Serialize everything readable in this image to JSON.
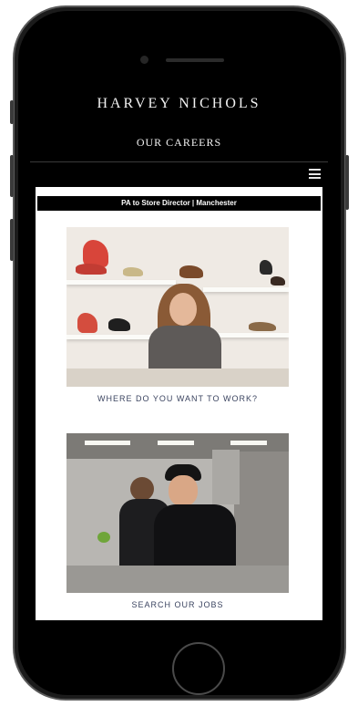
{
  "header": {
    "brand": "HARVEY NICHOLS",
    "subtitle": "OUR CAREERS",
    "menu_icon": "hamburger-menu-icon"
  },
  "job_bar": {
    "label": "PA to Store Director | Manchester"
  },
  "cards": [
    {
      "caption": "WHERE DO YOU WANT TO WORK?",
      "image": "store-photo"
    },
    {
      "caption": "SEARCH OUR JOBS",
      "image": "kitchen-photo"
    }
  ],
  "colors": {
    "screen_background": "#000000",
    "content_background": "#ffffff",
    "caption_text": "#3b4460"
  }
}
